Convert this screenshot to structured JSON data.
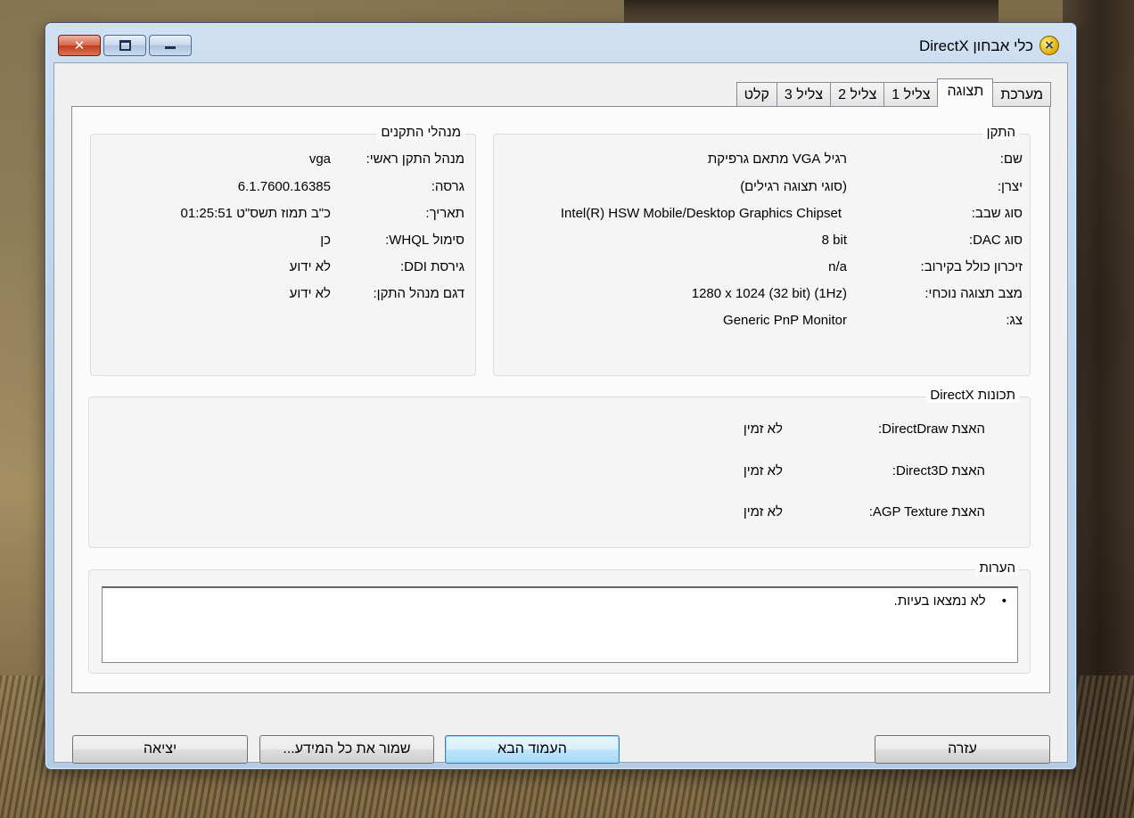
{
  "window": {
    "title": "כלי אבחון DirectX",
    "caption_buttons": {
      "close": "✕",
      "restore": "",
      "minimize": ""
    }
  },
  "tabs": [
    {
      "label": "מערכת",
      "active": false
    },
    {
      "label": "תצוגה",
      "active": true
    },
    {
      "label": "צליל 1",
      "active": false
    },
    {
      "label": "צליל 2",
      "active": false
    },
    {
      "label": "צליל 3",
      "active": false
    },
    {
      "label": "קלט",
      "active": false
    }
  ],
  "device": {
    "legend": "התקן",
    "rows": [
      {
        "label": "שם:",
        "value": "רגיל VGA מתאם גרפיקת"
      },
      {
        "label": "יצרן:",
        "value": "(סוגי תצוגה רגילים)"
      },
      {
        "label": "סוג שבב:",
        "value": "Intel(R) HSW Mobile/Desktop Graphics Chipset"
      },
      {
        "label": "סוג DAC:",
        "value": "8 bit"
      },
      {
        "label": "זיכרון כולל בקירוב:",
        "value": "n/a"
      },
      {
        "label": "מצב תצוגה נוכחי:",
        "value": "1280 x 1024 (32 bit) (1Hz)"
      },
      {
        "label": "צג:",
        "value": "Generic PnP Monitor"
      }
    ]
  },
  "drivers": {
    "legend": "מנהלי התקנים",
    "rows": [
      {
        "label": "מנהל התקן ראשי:",
        "value": "vga"
      },
      {
        "label": "גרסה:",
        "value": "6.1.7600.16385"
      },
      {
        "label": "תאריך:",
        "value": "כ\"ב תמוז תשס\"ט 01:25:51"
      },
      {
        "label": "סימול WHQL:",
        "value": "כן"
      },
      {
        "label": "גירסת DDI:",
        "value": "לא ידוע"
      },
      {
        "label": "דגם מנהל התקן:",
        "value": "לא ידוע"
      }
    ]
  },
  "features": {
    "legend": "תכונות DirectX",
    "rows": [
      {
        "label": "האצת DirectDraw:",
        "value": "לא זמין"
      },
      {
        "label": "האצת Direct3D:",
        "value": "לא זמין"
      },
      {
        "label": "האצת AGP Texture:",
        "value": "לא זמין"
      }
    ]
  },
  "notes": {
    "legend": "הערות",
    "items": [
      "לא נמצאו בעיות."
    ]
  },
  "buttons": {
    "help": "עזרה",
    "next_page": "העמוד הבא",
    "save_all": "שמור את כל המידע...",
    "exit": "יציאה"
  }
}
